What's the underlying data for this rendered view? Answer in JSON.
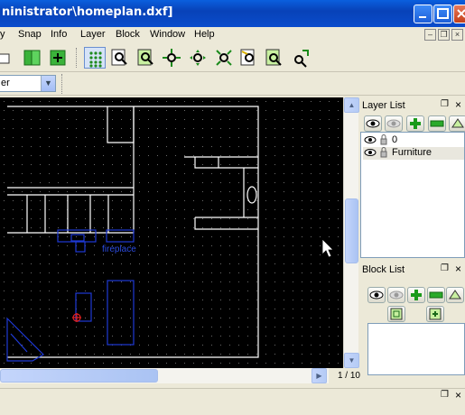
{
  "window": {
    "title": "ninistrator\\homeplan.dxf]"
  },
  "menu": {
    "items": [
      "y",
      "Snap",
      "Info",
      "Layer",
      "Block",
      "Window",
      "Help"
    ]
  },
  "mdi_controls": [
    "–",
    "❐",
    "×"
  ],
  "layer_combo": {
    "value": "er"
  },
  "toolbar": {
    "icons": [
      "new-icon",
      "open-icon",
      "new-layer-icon",
      "grid-icon",
      "zoom-icon",
      "zoom-window-icon",
      "zoom-in-icon",
      "zoom-out-icon",
      "zoom-auto-icon",
      "zoom-previous-icon",
      "zoom-select-icon",
      "zoom-pan-icon"
    ]
  },
  "drawing": {
    "fireplace_label": "fireplace"
  },
  "status": {
    "page": "1 / 10"
  },
  "layer_panel": {
    "title": "Layer List",
    "layers": [
      {
        "name": "0",
        "visible": true,
        "locked": false
      },
      {
        "name": "Furniture",
        "visible": true,
        "locked": false
      }
    ],
    "selected": "Furniture"
  },
  "block_panel": {
    "title": "Block List"
  },
  "colors": {
    "title_bar": "#0a52d6",
    "canvas": "#000000",
    "walls": "#ffffff",
    "furniture": "#1f3ad6",
    "selected_row": "#e9e7de"
  }
}
